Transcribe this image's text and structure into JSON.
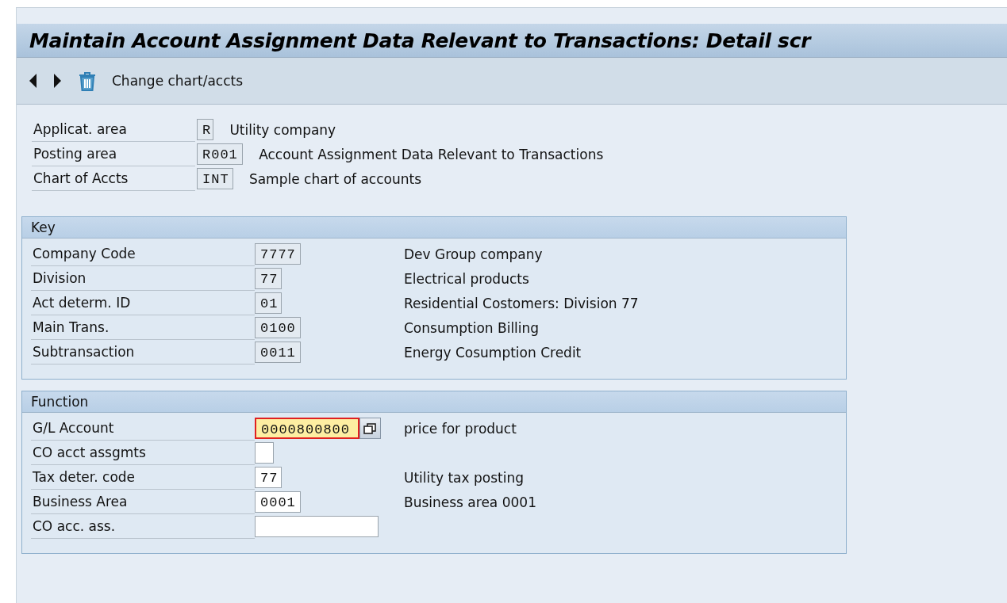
{
  "window": {
    "title": "Maintain Account Assignment Data Relevant to Transactions: Detail scr"
  },
  "toolbar": {
    "button": "Change chart/accts"
  },
  "header_fields": [
    {
      "label": "Applicat. area",
      "value": "R",
      "description": "Utility company"
    },
    {
      "label": "Posting area",
      "value": "R001",
      "description": "Account Assignment Data Relevant to Transactions"
    },
    {
      "label": "Chart of Accts",
      "value": "INT",
      "description": "Sample chart of accounts"
    }
  ],
  "groups": [
    {
      "title": "Key",
      "fields": [
        {
          "label": "Company Code",
          "kind": "display",
          "value": "7777",
          "description": "Dev Group company"
        },
        {
          "label": "Division",
          "kind": "display",
          "value": "77",
          "description": "Electrical products"
        },
        {
          "label": "Act determ. ID",
          "kind": "display",
          "value": "01",
          "description": "Residential Costomers: Division 77"
        },
        {
          "label": "Main Trans.",
          "kind": "display",
          "value": "0100",
          "description": "Consumption Billing"
        },
        {
          "label": "Subtransaction",
          "kind": "display",
          "value": "0011",
          "description": "Energy Cosumption Credit"
        }
      ]
    },
    {
      "title": "Function",
      "fields": [
        {
          "label": "G/L Account",
          "kind": "input",
          "value": "0000800800",
          "focused": true,
          "value_help": true,
          "description": "price for product"
        },
        {
          "label": "CO acct assgmts",
          "kind": "checkbox",
          "checked": false,
          "focused": false,
          "value_help": false
        },
        {
          "label": "Tax deter. code",
          "kind": "input",
          "value": "77",
          "focused": false,
          "value_help": false,
          "description": "Utility tax posting"
        },
        {
          "label": "Business Area",
          "kind": "input",
          "value": "0001",
          "focused": false,
          "value_help": false,
          "description": "Business area 0001"
        },
        {
          "label": "CO acc. ass.",
          "kind": "input",
          "wide": true,
          "focused": false,
          "value_help": false
        }
      ]
    }
  ]
}
